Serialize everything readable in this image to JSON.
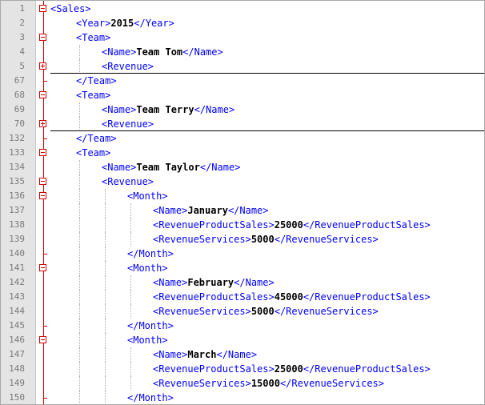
{
  "lines": [
    {
      "num": "1",
      "indent": 0,
      "open": "<Sales>",
      "text": "",
      "close": "",
      "fold": "minus",
      "folded": false
    },
    {
      "num": "2",
      "indent": 1,
      "open": "<Year>",
      "text": "2015",
      "close": "</Year>",
      "fold": "none",
      "folded": false
    },
    {
      "num": "3",
      "indent": 1,
      "open": "<Team>",
      "text": "",
      "close": "",
      "fold": "minus",
      "folded": false
    },
    {
      "num": "4",
      "indent": 2,
      "open": "<Name>",
      "text": "Team Tom",
      "close": "</Name>",
      "fold": "none",
      "folded": false
    },
    {
      "num": "5",
      "indent": 2,
      "open": "<Revenue>",
      "text": "",
      "close": "",
      "fold": "plus",
      "folded": true
    },
    {
      "num": "67",
      "indent": 1,
      "open": "</Team>",
      "text": "",
      "close": "",
      "fold": "end",
      "folded": false
    },
    {
      "num": "68",
      "indent": 1,
      "open": "<Team>",
      "text": "",
      "close": "",
      "fold": "minus",
      "folded": false
    },
    {
      "num": "69",
      "indent": 2,
      "open": "<Name>",
      "text": "Team Terry",
      "close": "</Name>",
      "fold": "none",
      "folded": false
    },
    {
      "num": "70",
      "indent": 2,
      "open": "<Revenue>",
      "text": "",
      "close": "",
      "fold": "plus",
      "folded": true
    },
    {
      "num": "132",
      "indent": 1,
      "open": "</Team>",
      "text": "",
      "close": "",
      "fold": "end",
      "folded": false
    },
    {
      "num": "133",
      "indent": 1,
      "open": "<Team>",
      "text": "",
      "close": "",
      "fold": "minus",
      "folded": false
    },
    {
      "num": "134",
      "indent": 2,
      "open": "<Name>",
      "text": "Team Taylor",
      "close": "</Name>",
      "fold": "none",
      "folded": false
    },
    {
      "num": "135",
      "indent": 2,
      "open": "<Revenue>",
      "text": "",
      "close": "",
      "fold": "minus",
      "folded": false
    },
    {
      "num": "136",
      "indent": 3,
      "open": "<Month>",
      "text": "",
      "close": "",
      "fold": "minus",
      "folded": false
    },
    {
      "num": "137",
      "indent": 4,
      "open": "<Name>",
      "text": "January",
      "close": "</Name>",
      "fold": "none",
      "folded": false
    },
    {
      "num": "138",
      "indent": 4,
      "open": "<RevenueProductSales>",
      "text": "25000",
      "close": "</RevenueProductSales>",
      "fold": "none",
      "folded": false
    },
    {
      "num": "139",
      "indent": 4,
      "open": "<RevenueServices>",
      "text": "5000",
      "close": "</RevenueServices>",
      "fold": "none",
      "folded": false
    },
    {
      "num": "140",
      "indent": 3,
      "open": "</Month>",
      "text": "",
      "close": "",
      "fold": "end",
      "folded": false
    },
    {
      "num": "141",
      "indent": 3,
      "open": "<Month>",
      "text": "",
      "close": "",
      "fold": "minus",
      "folded": false
    },
    {
      "num": "142",
      "indent": 4,
      "open": "<Name>",
      "text": "February",
      "close": "</Name>",
      "fold": "none",
      "folded": false
    },
    {
      "num": "143",
      "indent": 4,
      "open": "<RevenueProductSales>",
      "text": "45000",
      "close": "</RevenueProductSales>",
      "fold": "none",
      "folded": false
    },
    {
      "num": "144",
      "indent": 4,
      "open": "<RevenueServices>",
      "text": "5000",
      "close": "</RevenueServices>",
      "fold": "none",
      "folded": false
    },
    {
      "num": "145",
      "indent": 3,
      "open": "</Month>",
      "text": "",
      "close": "",
      "fold": "end",
      "folded": false
    },
    {
      "num": "146",
      "indent": 3,
      "open": "<Month>",
      "text": "",
      "close": "",
      "fold": "minus",
      "folded": false
    },
    {
      "num": "147",
      "indent": 4,
      "open": "<Name>",
      "text": "March",
      "close": "</Name>",
      "fold": "none",
      "folded": false
    },
    {
      "num": "148",
      "indent": 4,
      "open": "<RevenueProductSales>",
      "text": "25000",
      "close": "</RevenueProductSales>",
      "fold": "none",
      "folded": false
    },
    {
      "num": "149",
      "indent": 4,
      "open": "<RevenueServices>",
      "text": "15000",
      "close": "</RevenueServices>",
      "fold": "none",
      "folded": false
    },
    {
      "num": "150",
      "indent": 3,
      "open": "</Month>",
      "text": "",
      "close": "",
      "fold": "end",
      "folded": false
    }
  ]
}
